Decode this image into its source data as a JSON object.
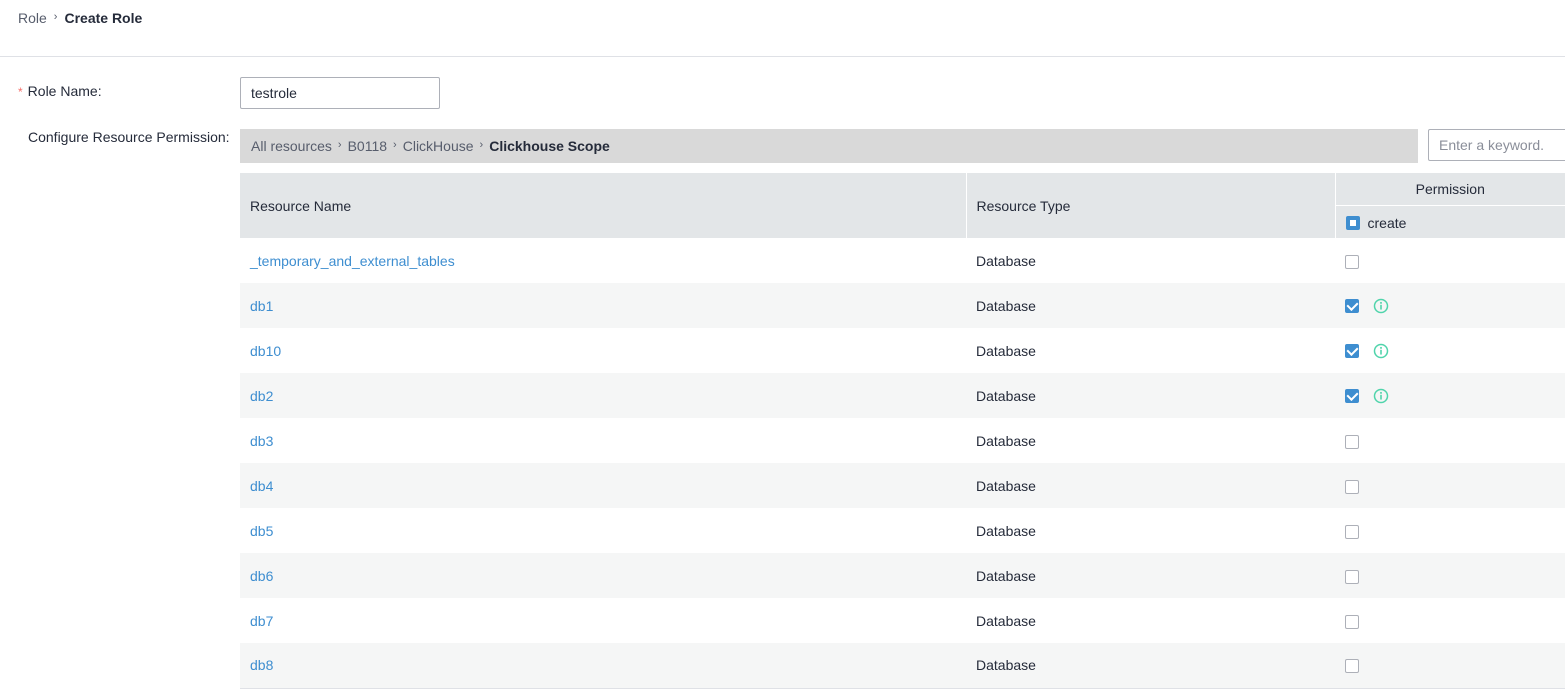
{
  "breadcrumb": {
    "parent": "Role",
    "current": "Create Role"
  },
  "form": {
    "role_name_label": "Role Name:",
    "required_mark": "*",
    "role_name_value": "testrole",
    "resource_permission_label": "Configure Resource Permission:"
  },
  "resource_path": {
    "items": [
      "All resources",
      "B0118",
      "ClickHouse"
    ],
    "current": "Clickhouse Scope"
  },
  "search": {
    "placeholder": "Enter a keyword."
  },
  "table": {
    "headers": {
      "resource_name": "Resource Name",
      "resource_type": "Resource Type",
      "permission": "Permission",
      "permission_create": "create"
    },
    "header_create_state": "indeterminate",
    "rows": [
      {
        "name": "_temporary_and_external_tables",
        "type": "Database",
        "create": false,
        "info": false
      },
      {
        "name": "db1",
        "type": "Database",
        "create": true,
        "info": true
      },
      {
        "name": "db10",
        "type": "Database",
        "create": true,
        "info": true
      },
      {
        "name": "db2",
        "type": "Database",
        "create": true,
        "info": true
      },
      {
        "name": "db3",
        "type": "Database",
        "create": false,
        "info": false
      },
      {
        "name": "db4",
        "type": "Database",
        "create": false,
        "info": false
      },
      {
        "name": "db5",
        "type": "Database",
        "create": false,
        "info": false
      },
      {
        "name": "db6",
        "type": "Database",
        "create": false,
        "info": false
      },
      {
        "name": "db7",
        "type": "Database",
        "create": false,
        "info": false
      },
      {
        "name": "db8",
        "type": "Database",
        "create": false,
        "info": false
      }
    ]
  },
  "colors": {
    "link": "#3e8ed0",
    "checkbox_checked": "#3e8ed0",
    "info_icon": "#50d4ab",
    "required": "#f66f6a",
    "header_bg": "#e3e6e8",
    "path_bar_bg": "#d9d9d9"
  },
  "icons": {
    "info": "info-circle-icon",
    "separator": "chevron-right-icon"
  }
}
